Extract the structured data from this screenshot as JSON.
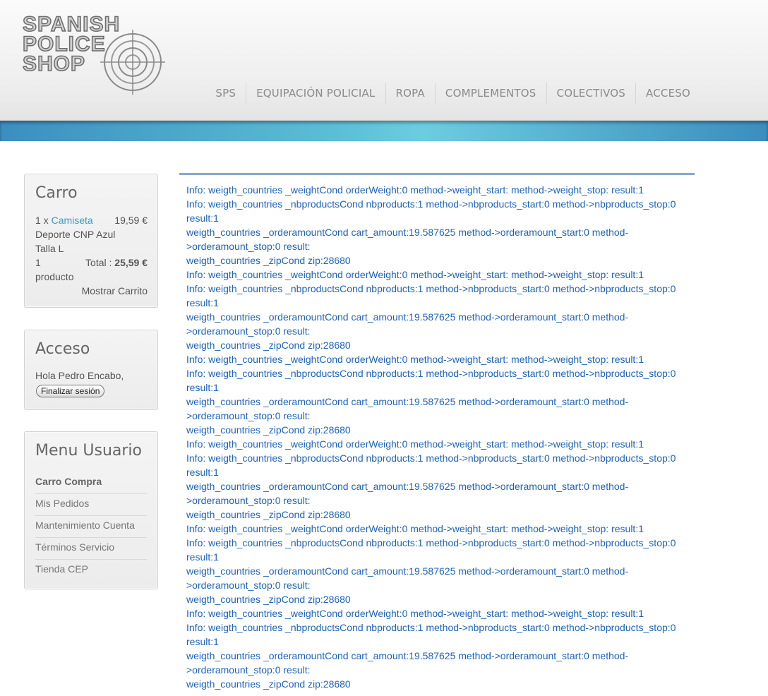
{
  "logo": {
    "line1": "SPANISH",
    "line2": "POLICE",
    "line3": "SHOP"
  },
  "nav": [
    "SPS",
    "EQUIPACIÓN POLICIAL",
    "ROPA",
    "COMPLEMENTOS",
    "COLECTIVOS",
    "ACCESO"
  ],
  "cart": {
    "title": "Carro",
    "qty": "1 x",
    "product_name_1": "Camiseta",
    "product_name_2": "Deporte CNP Azul",
    "price": "19,59 €",
    "variant": "Talla L",
    "count": "1",
    "count_label": "producto",
    "total_label": "Total :",
    "total_value": "25,59 €",
    "show_cart": "Mostrar Carrito"
  },
  "access": {
    "title": "Acceso",
    "greeting": "Hola Pedro Encabo,",
    "logout": "Finalizar sesión"
  },
  "menu": {
    "title": "Menu Usuario",
    "items": [
      "Carro Compra",
      "Mis Pedidos",
      "Mantenimiento Cuenta",
      "Términos Servicio",
      "Tienda CEP"
    ]
  },
  "log_lines": [
    "Info: weigth_countries _weightCond orderWeight:0 method->weight_start: method->weight_stop: result:1",
    "Info: weigth_countries _nbproductsCond nbproducts:1 method->nbproducts_start:0 method->nbproducts_stop:0 result:1",
    "weigth_countries _orderamountCond cart_amount:19.587625 method->orderamount_start:0 method->orderamount_stop:0 result:",
    "weigth_countries _zipCond zip:28680",
    "Info: weigth_countries _weightCond orderWeight:0 method->weight_start: method->weight_stop: result:1",
    "Info: weigth_countries _nbproductsCond nbproducts:1 method->nbproducts_start:0 method->nbproducts_stop:0 result:1",
    "weigth_countries _orderamountCond cart_amount:19.587625 method->orderamount_start:0 method->orderamount_stop:0 result:",
    "weigth_countries _zipCond zip:28680",
    "Info: weigth_countries _weightCond orderWeight:0 method->weight_start: method->weight_stop: result:1",
    "Info: weigth_countries _nbproductsCond nbproducts:1 method->nbproducts_start:0 method->nbproducts_stop:0 result:1",
    "weigth_countries _orderamountCond cart_amount:19.587625 method->orderamount_start:0 method->orderamount_stop:0 result:",
    "weigth_countries _zipCond zip:28680",
    "Info: weigth_countries _weightCond orderWeight:0 method->weight_start: method->weight_stop: result:1",
    "Info: weigth_countries _nbproductsCond nbproducts:1 method->nbproducts_start:0 method->nbproducts_stop:0 result:1",
    "weigth_countries _orderamountCond cart_amount:19.587625 method->orderamount_start:0 method->orderamount_stop:0 result:",
    "weigth_countries _zipCond zip:28680",
    "Info: weigth_countries _weightCond orderWeight:0 method->weight_start: method->weight_stop: result:1",
    "Info: weigth_countries _nbproductsCond nbproducts:1 method->nbproducts_start:0 method->nbproducts_stop:0 result:1",
    "weigth_countries _orderamountCond cart_amount:19.587625 method->orderamount_start:0 method->orderamount_stop:0 result:",
    "weigth_countries _zipCond zip:28680",
    "Info: weigth_countries _weightCond orderWeight:0 method->weight_start: method->weight_stop: result:1",
    "Info: weigth_countries _nbproductsCond nbproducts:1 method->nbproducts_start:0 method->nbproducts_stop:0 result:1",
    "weigth_countries _orderamountCond cart_amount:19.587625 method->orderamount_start:0 method->orderamount_stop:0 result:",
    "weigth_countries _zipCond zip:28680"
  ]
}
